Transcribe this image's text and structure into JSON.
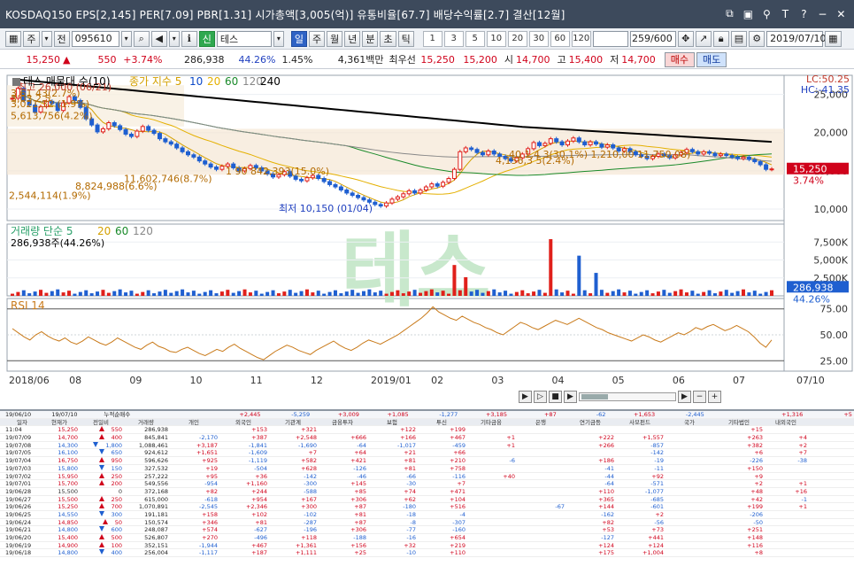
{
  "titlebar": {
    "title": "KOSDAQ150 EPS[2,145] PER[7.09] PBR[1.31] 시가총액[3,005(억)] 유통비율[67.7] 배당수익률[2.7] 결산[12월]",
    "icons": [
      "window-icon",
      "window-icon",
      "pin-icon",
      "text-icon",
      "help-icon",
      "minimize-icon",
      "close-icon"
    ]
  },
  "toolbar": {
    "type_label": "주",
    "all_label": "전",
    "code": "095610",
    "stock_badge": "신",
    "stock_name": "테스",
    "periods": [
      "일",
      "주",
      "월",
      "년",
      "분",
      "초",
      "틱"
    ],
    "active_period": "일",
    "intervals": [
      "1",
      "3",
      "5",
      "10",
      "20",
      "30",
      "60",
      "120"
    ],
    "count": "259/600",
    "date": "2019/07/10"
  },
  "quote": {
    "price": "15,250",
    "change": "550",
    "change_pct": "+3.74%",
    "volume": "286,938",
    "vol_ratio": "44.26%",
    "turnover": "1.45%",
    "amount": "4,361백만",
    "best_label": "최우선",
    "best_ask": "15,250",
    "best_bid": "15,200",
    "open_label": "시",
    "open": "14,700",
    "high_label": "고",
    "high": "15,400",
    "low_label": "저",
    "low": "14,700",
    "buy_label": "매수",
    "sell_label": "매도"
  },
  "chart_data": [
    {
      "type": "candlestick",
      "title": "테스 매물대 수(10)",
      "legend": [
        "종가 지수 5",
        "10",
        "20",
        "60",
        "120",
        "240"
      ],
      "legend_colors": [
        "#d4a000",
        "#0a48c8",
        "#e4b000",
        "#1a8a2a",
        "#888888",
        "#000000"
      ],
      "ylim": [
        8500,
        27500
      ],
      "yticks": [
        10000,
        15000,
        20000,
        25000
      ],
      "current_price": 15250,
      "current_pct": "3.74%",
      "lc": "LC:50.25",
      "hc": "HC:-41.35",
      "x_labels": [
        "2018/06",
        "08",
        "09",
        "10",
        "11",
        "12",
        "2019/01",
        "02",
        "03",
        "04",
        "05",
        "06",
        "07",
        "07/10"
      ],
      "annotations": {
        "high": "최고 26,000 (06/21)",
        "low": "최저 10,150 (01/04)"
      },
      "volume_profile": [
        {
          "price": 25200,
          "label": "3,61 43(2.7%)"
        },
        {
          "price": 24500,
          "label": "3,03 2,5"
        },
        {
          "price": 23800,
          "label": "3,021,32 (1.9%)"
        },
        {
          "price": 22200,
          "label": "5,613,756(4.2%)"
        },
        {
          "price": 17200,
          "label": "40 1,4 3(30.1%)   1,210,00  11,750,08)"
        },
        {
          "price": 16400,
          "label": "4,156,3 5(2.4%)"
        },
        {
          "price": 15000,
          "label": "1 90 842,393(15.0%)"
        },
        {
          "price": 14000,
          "label": "11,602,746(8.7%)"
        },
        {
          "price": 13000,
          "label": "8,824,988(6.6%)"
        },
        {
          "price": 11800,
          "label": "2,544,114(1.9%)"
        }
      ],
      "closes": [
        24500,
        25800,
        24200,
        23600,
        22700,
        23400,
        24100,
        23800,
        22900,
        23900,
        24700,
        24200,
        23300,
        21800,
        21000,
        20100,
        20500,
        21300,
        20900,
        20400,
        19800,
        19500,
        20200,
        20800,
        20300,
        19900,
        19200,
        18800,
        18500,
        18000,
        17500,
        17100,
        16800,
        16300,
        15900,
        15500,
        15200,
        15600,
        15900,
        15400,
        15000,
        15300,
        15700,
        15400,
        15000,
        14600,
        14200,
        14500,
        14900,
        14300,
        13900,
        13700,
        14100,
        14400,
        14000,
        13600,
        13200,
        12900,
        12500,
        12100,
        11800,
        11500,
        11200,
        10900,
        10600,
        10400,
        10800,
        11300,
        11600,
        12000,
        12400,
        12100,
        12500,
        12900,
        13300,
        13000,
        13500,
        14000,
        15200,
        17500,
        18000,
        17800,
        17400,
        17100,
        17600,
        17200,
        16900,
        16600,
        16300,
        16700,
        17200,
        17900,
        18700,
        18300,
        18600,
        19200,
        18800,
        18400,
        18900,
        19300,
        18800,
        18400,
        18800,
        18500,
        18100,
        18400,
        18000,
        17600,
        17900,
        17500,
        17100,
        16900,
        16600,
        16900,
        17200,
        17000,
        16700,
        17100,
        17400,
        17800,
        17500,
        17200,
        17500,
        17300,
        17000,
        17200,
        17000,
        16800,
        16600,
        16800,
        16500,
        16200,
        15800,
        15200,
        15250
      ]
    },
    {
      "type": "bar",
      "title": "거래량 단순 5",
      "legend": [
        "5",
        "20",
        "60",
        "120"
      ],
      "legend_colors": [
        "#2aa06a",
        "#d4a000",
        "#1a8a2a",
        "#888888"
      ],
      "summary": "286,938주(44.26%)",
      "ylim": [
        0,
        10000
      ],
      "yticks": [
        2500,
        5000,
        7500
      ],
      "ytick_labels": [
        "2,500K",
        "5,000K",
        "7,500K"
      ],
      "current_value": "286,938",
      "current_pct": "44.26%",
      "spikes": [
        {
          "index": 78,
          "value": 4300
        },
        {
          "index": 95,
          "value": 7900
        },
        {
          "index": 100,
          "value": 5600
        },
        {
          "index": 103,
          "value": 3200
        },
        {
          "index": 80,
          "value": 2600
        }
      ]
    },
    {
      "type": "line",
      "title": "RSI 14",
      "ylim": [
        15,
        85
      ],
      "yticks": [
        25,
        50,
        75
      ],
      "ytick_labels": [
        "25.00",
        "50.00",
        "75.00"
      ],
      "values": [
        56,
        52,
        48,
        45,
        50,
        53,
        49,
        46,
        44,
        47,
        43,
        41,
        44,
        48,
        45,
        42,
        40,
        43,
        47,
        44,
        41,
        38,
        36,
        40,
        43,
        39,
        37,
        34,
        33,
        36,
        38,
        35,
        32,
        30,
        33,
        36,
        34,
        38,
        41,
        37,
        34,
        31,
        28,
        26,
        30,
        34,
        37,
        40,
        38,
        35,
        33,
        31,
        35,
        38,
        41,
        44,
        40,
        37,
        35,
        38,
        42,
        45,
        43,
        41,
        44,
        47,
        50,
        54,
        58,
        62,
        66,
        71,
        77,
        72,
        69,
        66,
        64,
        68,
        65,
        62,
        60,
        57,
        55,
        52,
        50,
        54,
        58,
        62,
        60,
        57,
        55,
        58,
        61,
        64,
        62,
        60,
        63,
        66,
        63,
        60,
        57,
        55,
        52,
        50,
        48,
        46,
        44,
        47,
        50,
        48,
        45,
        43,
        46,
        49,
        52,
        50,
        53,
        57,
        55,
        58,
        60,
        57,
        54,
        56,
        59,
        56,
        53,
        48,
        42,
        38,
        45
      ]
    }
  ],
  "watermark": "테스",
  "table": {
    "filter_date1": "19/06/10",
    "filter_date2": "19/07/10",
    "filter_label": "누적순매수",
    "columns": [
      "일자",
      "현재가",
      "전일비",
      "거래량",
      "개인",
      "외국인",
      "기관계",
      "금융투자",
      "보험",
      "투신",
      "기타금융",
      "은행",
      "연기금등",
      "사모펀드",
      "국가",
      "기타법인",
      "내외국인"
    ],
    "totals": [
      "+2,445",
      "-5,259",
      "+3,009",
      "+1,085",
      "-1,277",
      "+3,185",
      "+87",
      "-62",
      "+1,653",
      "-2,445",
      "",
      "+1,316",
      "+5"
    ],
    "rows": [
      [
        "11:04",
        "15,250",
        "up",
        "550",
        "286,938",
        "",
        "+153",
        "+321",
        "",
        "+122",
        "+199",
        "",
        "",
        "",
        "",
        "",
        "+15",
        ""
      ],
      [
        "19/07/09",
        "14,700",
        "up",
        "400",
        "845,841",
        "-2,170",
        "+387",
        "+2,548",
        "+666",
        "+166",
        "+467",
        "+1",
        "",
        "+222",
        "+1,557",
        "",
        "+263",
        "+4"
      ],
      [
        "19/07/08",
        "14,300",
        "dn",
        "1,800",
        "1,088,461",
        "+3,187",
        "-1,841",
        "-1,690",
        "-64",
        "-1,017",
        "-459",
        "+1",
        "",
        "+266",
        "-857",
        "",
        "+382",
        "+2"
      ],
      [
        "19/07/05",
        "16,100",
        "dn",
        "650",
        "924,612",
        "+1,651",
        "-1,609",
        "+7",
        "+64",
        "+21",
        "+66",
        "",
        "",
        "",
        "-142",
        "",
        "+6",
        "+7"
      ],
      [
        "19/07/04",
        "16,750",
        "up",
        "950",
        "596,626",
        "+925",
        "-1,119",
        "+582",
        "+421",
        "+81",
        "+210",
        "-6",
        "",
        "+186",
        "-19",
        "",
        "-226",
        "-38"
      ],
      [
        "19/07/03",
        "15,800",
        "dn",
        "150",
        "327,532",
        "+19",
        "-504",
        "+628",
        "-126",
        "+81",
        "+758",
        "",
        "",
        "-41",
        "-11",
        "",
        "+150",
        ""
      ],
      [
        "19/07/02",
        "15,950",
        "up",
        "250",
        "257,222",
        "+95",
        "+36",
        "-142",
        "-46",
        "-66",
        "-116",
        "+40",
        "",
        "-44",
        "+92",
        "",
        "+9",
        ""
      ],
      [
        "19/07/01",
        "15,700",
        "up",
        "200",
        "549,556",
        "-954",
        "+1,160",
        "-300",
        "+145",
        "-30",
        "+7",
        "",
        "",
        "-64",
        "-571",
        "",
        "+2",
        "+1"
      ],
      [
        "19/06/28",
        "15,500",
        "",
        "0",
        "372,168",
        "+82",
        "+244",
        "-588",
        "+85",
        "+74",
        "+471",
        "",
        "",
        "+110",
        "-1,077",
        "",
        "+48",
        "+16"
      ],
      [
        "19/06/27",
        "15,500",
        "up",
        "250",
        "615,000",
        "-618",
        "+954",
        "+167",
        "+306",
        "+62",
        "+104",
        "",
        "",
        "+365",
        "-685",
        "",
        "+42",
        "-1"
      ],
      [
        "19/06/26",
        "15,250",
        "up",
        "700",
        "1,070,891",
        "-2,545",
        "+2,346",
        "+300",
        "+87",
        "-180",
        "+516",
        "",
        "-67",
        "+144",
        "-601",
        "",
        "+199",
        "+1"
      ],
      [
        "19/06/25",
        "14,550",
        "dn",
        "300",
        "191,181",
        "+158",
        "+102",
        "-102",
        "+81",
        "-18",
        "-4",
        "",
        "",
        "-162",
        "+2",
        "",
        "-206",
        ""
      ],
      [
        "19/06/24",
        "14,850",
        "up",
        "50",
        "150,574",
        "+346",
        "+81",
        "-287",
        "+87",
        "-8",
        "-307",
        "",
        "",
        "+82",
        "-56",
        "",
        "-50",
        ""
      ],
      [
        "19/06/21",
        "14,800",
        "dn",
        "600",
        "248,087",
        "+574",
        "-627",
        "-196",
        "+306",
        "-77",
        "-160",
        "",
        "",
        "+53",
        "+73",
        "",
        "+251",
        ""
      ],
      [
        "19/06/20",
        "15,400",
        "up",
        "500",
        "526,807",
        "+270",
        "-496",
        "+118",
        "-188",
        "-16",
        "+654",
        "",
        "",
        "-127",
        "+441",
        "",
        "+148",
        ""
      ],
      [
        "19/06/19",
        "14,900",
        "up",
        "100",
        "352,151",
        "-1,944",
        "+467",
        "+1,361",
        "+156",
        "+32",
        "+219",
        "",
        "",
        "+124",
        "+124",
        "",
        "+116",
        ""
      ],
      [
        "19/06/18",
        "14,800",
        "dn",
        "400",
        "256,004",
        "-1,117",
        "+187",
        "+1,111",
        "+25",
        "-10",
        "+110",
        "",
        "",
        "+175",
        "+1,004",
        "",
        "+8",
        ""
      ]
    ]
  }
}
